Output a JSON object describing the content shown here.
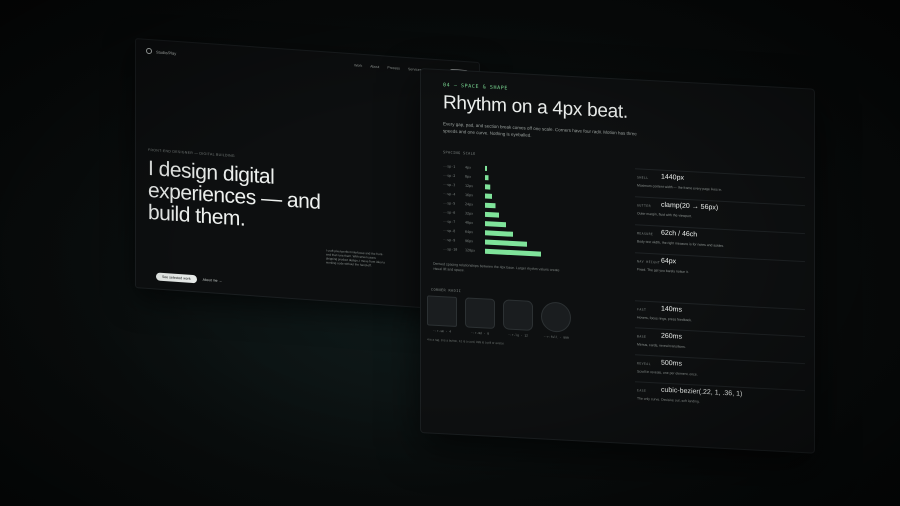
{
  "left_panel": {
    "nav": {
      "logo": "Studio/Play",
      "links": [
        "Work",
        "About",
        "Process",
        "Services",
        "Journal"
      ],
      "cta": "Contact"
    },
    "eyebrow": "FRONT-END DESIGNER — DIGITAL BUILDING",
    "hero_lines": [
      "I design digital",
      "experiences — and",
      "build them."
    ],
    "description": "I craft pixel-perfect interfaces and the front-end that runs them. With seven years shipping product design, I move from idea to working code without the hand-off.",
    "primary_button": "See selected work",
    "secondary_button": "About me →"
  },
  "right_panel": {
    "eyebrow": "04 — SPACE & SHAPE",
    "title": "Rhythm on a 4px beat.",
    "subtitle": "Every gap, pad, and section break comes off one scale. Corners have four radii. Motion has three speeds and one curve. Nothing is eyeballed.",
    "spacing_label": "SPACING SCALE",
    "chart_note": "Derived spacing relationships between the 4px base. Larger rhythm values create visual lift and space.",
    "radii_label": "CORNER RADII",
    "radii": [
      {
        "caption": "--r-sm · 4"
      },
      {
        "caption": "--r-md · 8"
      },
      {
        "caption": "--r-lg · 12"
      },
      {
        "caption": "--r-full · 999"
      }
    ],
    "radii_note": "4 is a tag, 8 is a button, 12 is a card, 999 is a pill or avatar.",
    "layout_specs": [
      {
        "key": "SHELL",
        "value": "1440px",
        "desc": "Maximum content width — the frame every page lives in."
      },
      {
        "key": "GUTTER",
        "value": "clamp(20 → 56px)",
        "desc": "Outer margin, fluid with the viewport."
      },
      {
        "key": "MEASURE",
        "value": "62ch / 46ch",
        "desc": "Body text width, the right measure is for notes and asides."
      },
      {
        "key": "NAV HEIGHT",
        "value": "64px",
        "desc": "Fixed. The gel you barely notice it."
      }
    ],
    "motion_specs": [
      {
        "key": "FAST",
        "value": "140ms",
        "desc": "Hovers, focus rings, press feedback."
      },
      {
        "key": "BASE",
        "value": "260ms",
        "desc": "Menus, cards, reveal transitions."
      },
      {
        "key": "REVEAL",
        "value": "500ms",
        "desc": "Scroll-in reveals, one per element, once."
      },
      {
        "key": "EASE",
        "value": "cubic-bezier(.22, 1, .36, 1)",
        "desc": "The only curve. Decisive out, soft landing."
      }
    ]
  },
  "chart_data": {
    "type": "bar",
    "orientation": "horizontal",
    "title": "SPACING SCALE",
    "categories": [
      "--sp-1",
      "--sp-2",
      "--sp-3",
      "--sp-4",
      "--sp-5",
      "--sp-6",
      "--sp-7",
      "--sp-8",
      "--sp-9",
      "--sp-10"
    ],
    "values": [
      4,
      8,
      12,
      16,
      24,
      32,
      48,
      64,
      96,
      128
    ],
    "value_labels": [
      "4px",
      "8px",
      "12px",
      "16px",
      "24px",
      "32px",
      "48px",
      "64px",
      "96px",
      "128px"
    ],
    "bar_color": "#7fe39a"
  },
  "colors": {
    "accent": "#7fe39a",
    "panel_bg": "#0e1011",
    "text": "#eef1ef",
    "muted": "#8d9491"
  }
}
